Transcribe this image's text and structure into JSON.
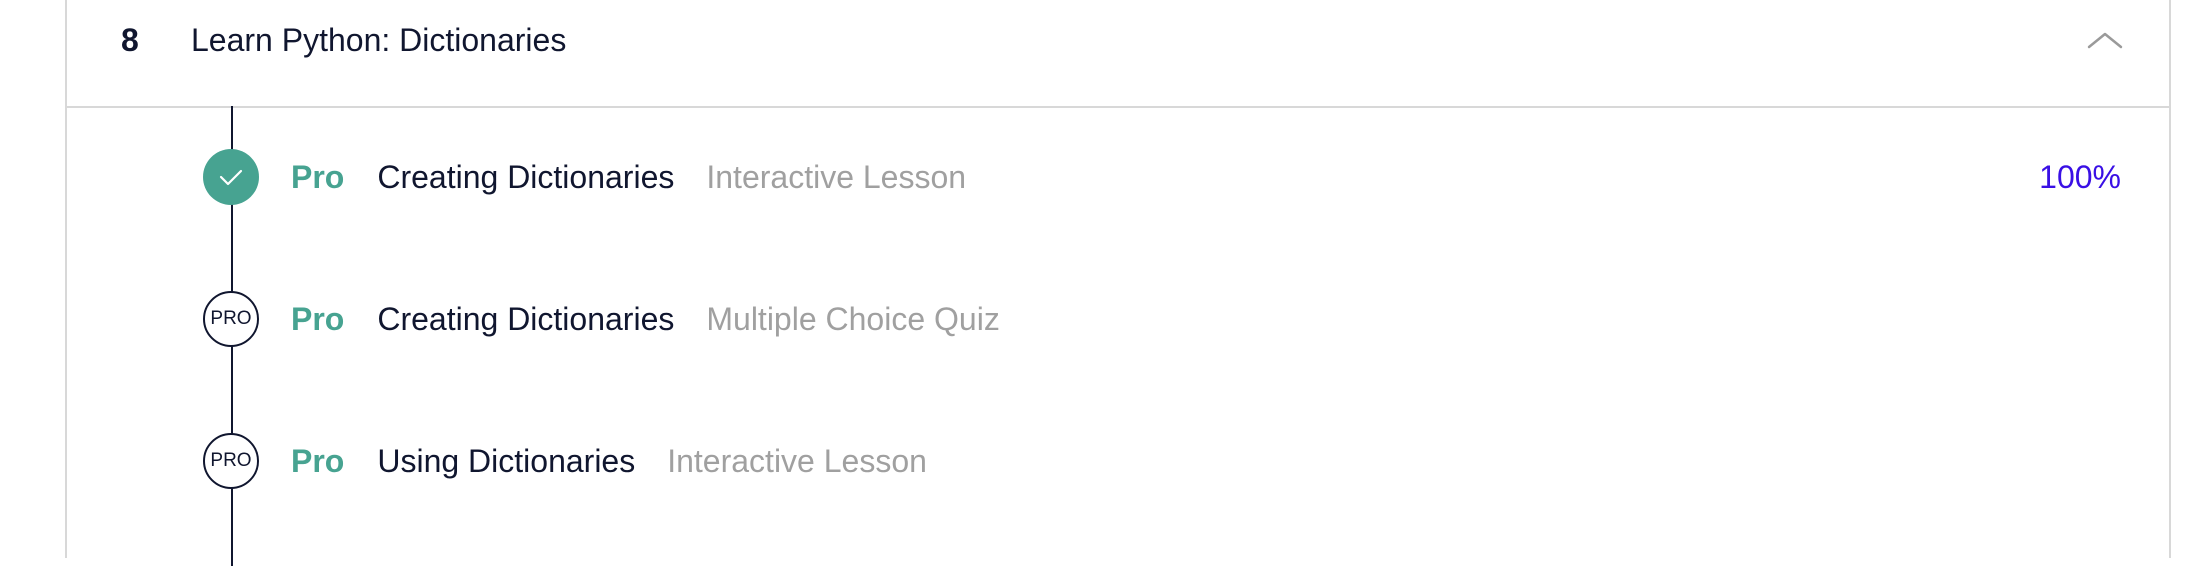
{
  "module": {
    "number": "8",
    "title": "Learn Python: Dictionaries",
    "toggle_icon": "chevron-up-icon"
  },
  "lessons": [
    {
      "status": "completed",
      "status_icon": "check-icon",
      "pro_label": "Pro",
      "title": "Creating Dictionaries",
      "type": "Interactive Lesson",
      "progress": "100%"
    },
    {
      "status": "locked",
      "status_icon": "pro-badge-icon",
      "badge_text": "PRO",
      "pro_label": "Pro",
      "title": "Creating Dictionaries",
      "type": "Multiple Choice Quiz"
    },
    {
      "status": "locked",
      "status_icon": "pro-badge-icon",
      "badge_text": "PRO",
      "pro_label": "Pro",
      "title": "Using Dictionaries",
      "type": "Interactive Lesson"
    }
  ],
  "colors": {
    "navy": "#10162f",
    "teal": "#47a391",
    "muted": "#a0a0a0",
    "progress_blue": "#3a10e5",
    "border": "#d8d8d8"
  }
}
